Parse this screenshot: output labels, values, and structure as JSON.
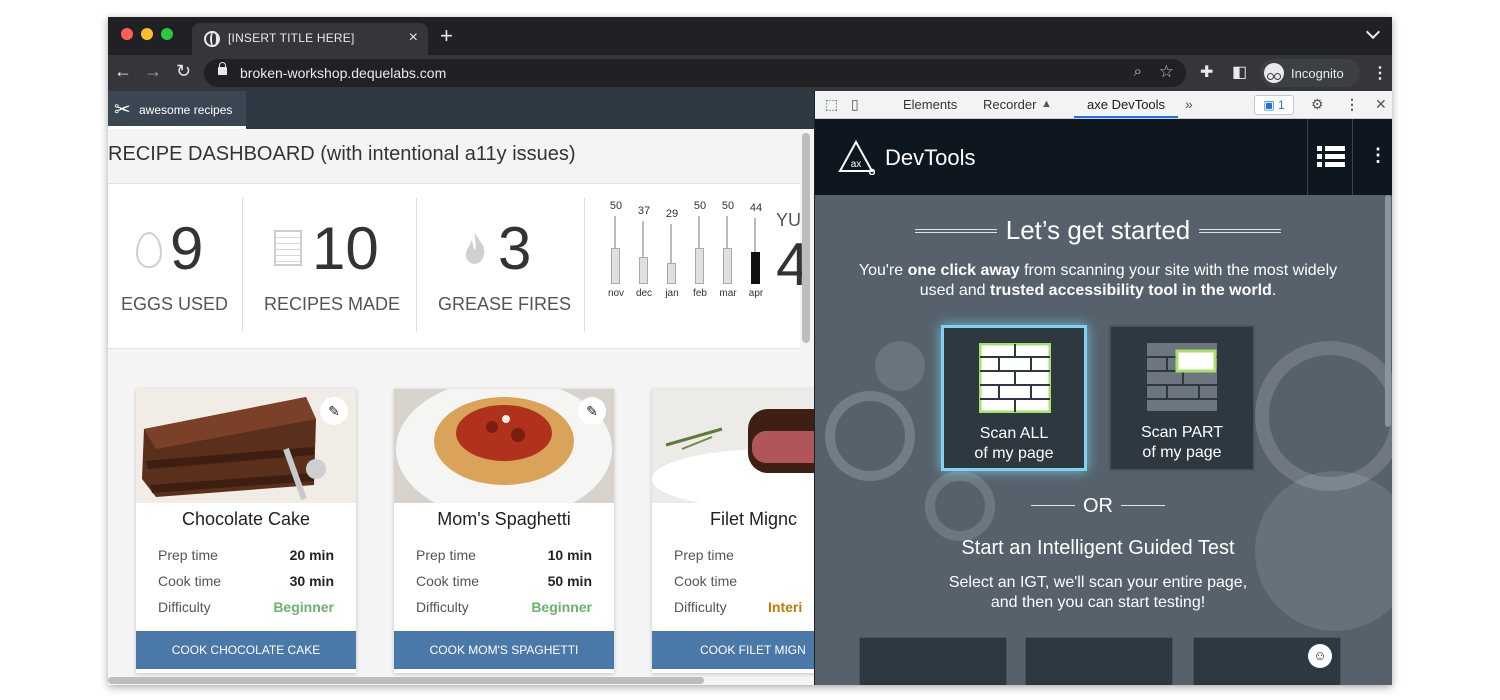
{
  "browser": {
    "tab_title": "[INSERT TITLE HERE]",
    "url": "broken-workshop.dequelabs.com",
    "profile_label": "Incognito"
  },
  "site": {
    "brand": "awesome recipes",
    "dashboard_title": "RECIPE DASHBOARD (with intentional a11y issues)",
    "stats": [
      {
        "value": "9",
        "label": "EGGS USED"
      },
      {
        "value": "10",
        "label": "RECIPES MADE"
      },
      {
        "value": "3",
        "label": "GREASE FIRES"
      }
    ],
    "partial_stat_label": "YU",
    "partial_stat_value": "4",
    "chart_data": {
      "type": "bar",
      "categories": [
        "nov",
        "dec",
        "jan",
        "feb",
        "mar",
        "apr"
      ],
      "values": [
        50,
        37,
        29,
        50,
        50,
        44
      ],
      "highlight_index": 5
    },
    "recipes": [
      {
        "name": "Chocolate Cake",
        "prep_label": "Prep time",
        "prep": "20 min",
        "cook_label": "Cook time",
        "cook": "30 min",
        "difficulty_label": "Difficulty",
        "difficulty": "Beginner",
        "button": "COOK CHOCOLATE CAKE"
      },
      {
        "name": "Mom's Spaghetti",
        "prep_label": "Prep time",
        "prep": "10 min",
        "cook_label": "Cook time",
        "cook": "50 min",
        "difficulty_label": "Difficulty",
        "difficulty": "Beginner",
        "button": "COOK MOM'S SPAGHETTI"
      },
      {
        "name": "Filet Mignc",
        "prep_label": "Prep time",
        "prep": "",
        "cook_label": "Cook time",
        "cook": "",
        "difficulty_label": "Difficulty",
        "difficulty": "Interi",
        "button": "COOK FILET MIGN"
      }
    ]
  },
  "devtools": {
    "tabs": [
      "Elements",
      "Recorder",
      "axe DevTools"
    ],
    "active_tab": "axe DevTools",
    "issue_count": "1",
    "axe": {
      "product": "DevTools",
      "heading": "Let’s get started",
      "intro_1": "You're ",
      "intro_bold_1": "one click away",
      "intro_2": " from scanning your site with the most widely used and ",
      "intro_bold_2": "trusted accessibility tool in the world",
      "intro_3": ".",
      "scan_all_line1": "Scan ALL",
      "scan_all_line2": "of my page",
      "scan_part_line1": "Scan PART",
      "scan_part_line2": "of my page",
      "or": "OR",
      "igt_title": "Start an Intelligent Guided Test",
      "igt_sub_1": "Select an IGT, we'll scan your entire page,",
      "igt_sub_2": "and then you can start testing!"
    }
  },
  "colors": {
    "accent": "#4a78a8",
    "beginner": "#6ab36a",
    "axe_select": "#7fd3f0"
  }
}
